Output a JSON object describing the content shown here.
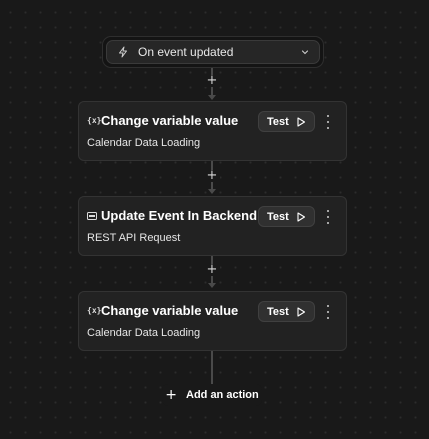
{
  "trigger": {
    "icon": "lightning-bolt-icon",
    "label": "On event updated",
    "dropdown_icon": "chevron-down-icon"
  },
  "connector_add_symbol": "+",
  "actions": [
    {
      "icon": "variable-icon",
      "icon_text": "{x}",
      "title": "Change variable value",
      "subtitle": "Calendar Data Loading",
      "test_label": "Test"
    },
    {
      "icon": "api-card-icon",
      "icon_text": "",
      "title": "Update Event In Backend",
      "subtitle": "REST API Request",
      "test_label": "Test"
    },
    {
      "icon": "variable-icon",
      "icon_text": "{x}",
      "title": "Change variable value",
      "subtitle": "Calendar Data Loading",
      "test_label": "Test"
    }
  ],
  "add_action": {
    "symbol": "+",
    "label": "Add an action"
  },
  "colors": {
    "canvas_bg": "#191919",
    "card_bg": "#222222",
    "card_border": "#333333",
    "connector": "#4a4a4a"
  }
}
